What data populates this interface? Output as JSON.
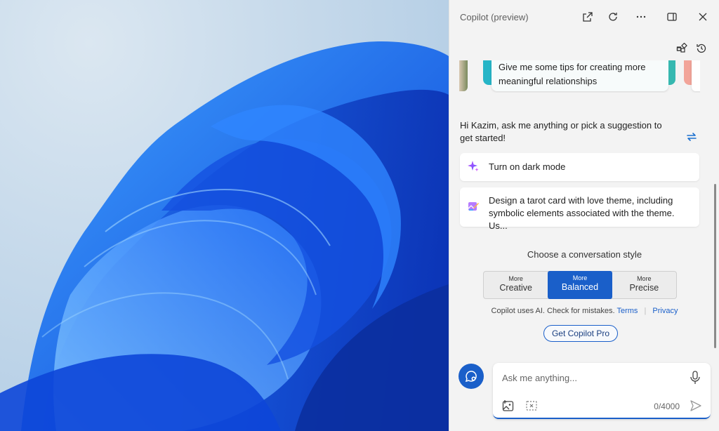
{
  "window": {
    "title": "Copilot (preview)"
  },
  "suggestion_card": {
    "text": "Give me some tips for creating more meaningful relationships"
  },
  "greeting": "Hi Kazim, ask me anything or pick a suggestion to get started!",
  "suggestions": [
    {
      "text": "Turn on dark mode",
      "icon": "sparkle-icon"
    },
    {
      "text": "Design a tarot card with love theme, including symbolic elements associated with the theme. Us...",
      "icon": "image-create-icon"
    }
  ],
  "conversation_style": {
    "title": "Choose a conversation style",
    "options": [
      {
        "small": "More",
        "label": "Creative",
        "active": false
      },
      {
        "small": "More",
        "label": "Balanced",
        "active": true
      },
      {
        "small": "More",
        "label": "Precise",
        "active": false
      }
    ]
  },
  "disclaimer": {
    "text": "Copilot uses AI. Check for mistakes.",
    "terms": "Terms",
    "privacy": "Privacy"
  },
  "pro_button": "Get Copilot Pro",
  "input": {
    "placeholder": "Ask me anything...",
    "counter": "0/4000"
  },
  "colors": {
    "accent": "#1a5fc9",
    "pane_background": "#f3f3f3"
  }
}
